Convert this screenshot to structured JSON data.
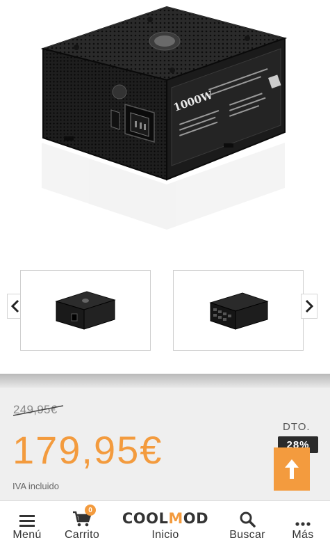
{
  "product": {
    "main_image_alt": "1000W",
    "psu_model_text": "1000W"
  },
  "carousel": {
    "prev_icon": "chevron-left-icon",
    "next_icon": "chevron-right-icon"
  },
  "pricing": {
    "old_price": "249,95€",
    "new_price": "179,95€",
    "tax_note": "IVA incluido",
    "discount_label": "DTO.",
    "discount_value": "28%"
  },
  "colors": {
    "accent": "#f39b3e",
    "badge_bg": "#2b2b2b",
    "panel_bg": "#efefef"
  },
  "bottom_nav": {
    "menu_label": "Menú",
    "cart_label": "Carrito",
    "cart_count": "0",
    "logo_prefix": "COOL",
    "logo_m": "M",
    "logo_suffix": "OD",
    "home_label": "Inicio",
    "search_label": "Buscar",
    "more_label": "Más"
  }
}
